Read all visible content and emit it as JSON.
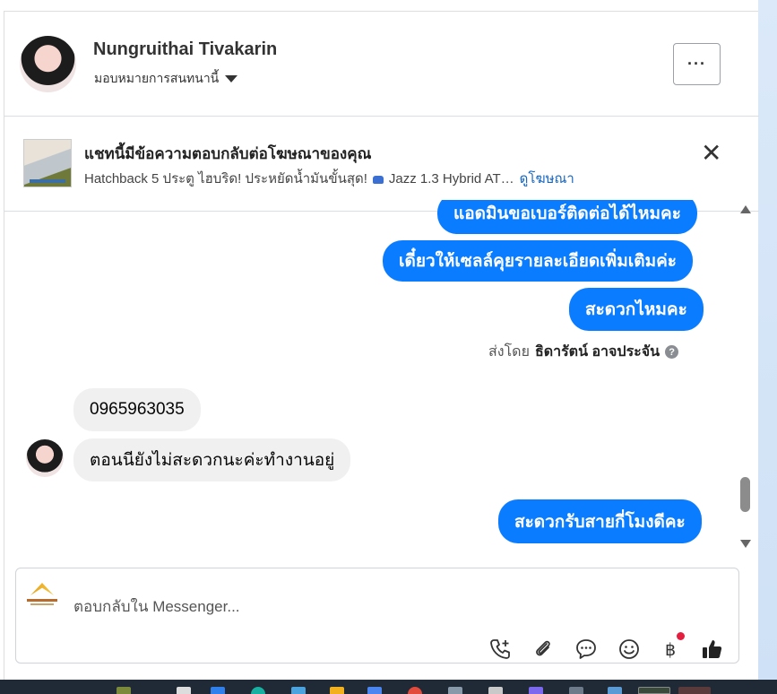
{
  "header": {
    "contact_name": "Nungruithai Tivakarin",
    "assign_label": "มอบหมายการสนทนานี้",
    "more_label": "···"
  },
  "ad_banner": {
    "title": "แชทนี้มีข้อความตอบกลับต่อโฆษณาของคุณ",
    "subtitle": "Hatchback 5 ประตู ไฮบริด! ประหยัดน้ำมันขั้นสุด!",
    "subtitle_tail": "Jazz 1.3 Hybrid AT…",
    "link_label": "ดูโฆษณา",
    "close_label": "✕"
  },
  "messages": [
    {
      "direction": "out",
      "text": "แอดมินขอเบอร์ติดต่อได้ไหมคะ"
    },
    {
      "direction": "out",
      "text": "เดี๋ยวให้เซลล์คุยรายละเอียดเพิ่มเติมค่ะ"
    },
    {
      "direction": "out",
      "text": "สะดวกไหมคะ"
    },
    {
      "direction": "in",
      "text": "0965963035"
    },
    {
      "direction": "in",
      "text": "ตอนนียังไม่สะดวกนะค่ะทำงานอยู่"
    },
    {
      "direction": "out",
      "text": "สะดวกรับสายกี่โมงดีคะ"
    }
  ],
  "sent_by": {
    "prefix": "ส่งโดย",
    "name": "ธิดารัตน์ อาจประจัน",
    "help": "?"
  },
  "composer": {
    "placeholder": "ตอบกลับใน Messenger...",
    "tools": [
      "phone-plus-icon",
      "paperclip-icon",
      "chat-bubble-icon",
      "emoji-icon",
      "baht-icon",
      "thumbs-up-icon"
    ]
  },
  "colors": {
    "outgoing_bubble": "#0a7cff",
    "incoming_bubble": "#f0f0f0",
    "link": "#1565c0",
    "notification": "#e41e3f"
  }
}
